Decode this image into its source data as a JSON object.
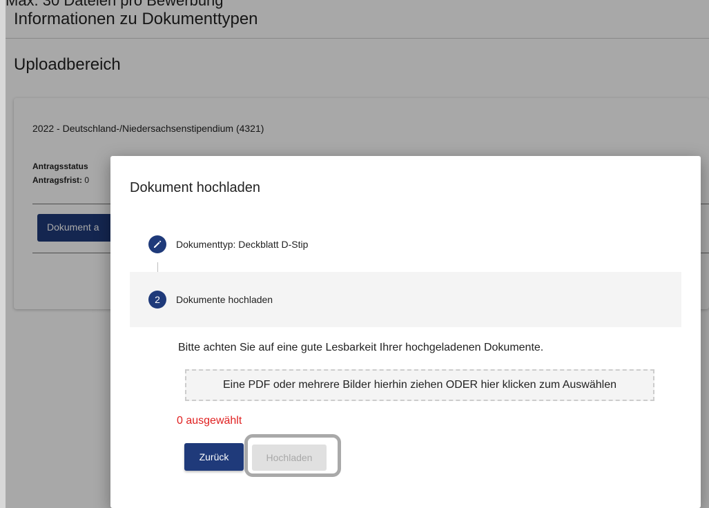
{
  "background": {
    "top_clipped_text": "Max. 30 Dateien pro Bewerbung",
    "info_title": "Informationen zu Dokumenttypen",
    "upload_title": "Uploadbereich",
    "card": {
      "program": "2022 - Deutschland-/Niedersachsenstipendium (4321)",
      "status_label": "Antragsstatus",
      "deadline_label": "Antragsfrist:",
      "deadline_value": "0",
      "button_label": "Dokument a"
    }
  },
  "dialog": {
    "title": "Dokument hochladen",
    "step1": {
      "label": "Dokumenttyp: Deckblatt D-Stip",
      "icon": "pencil-icon"
    },
    "step2": {
      "number": "2",
      "label": "Dokumente hochladen"
    },
    "note": "Bitte achten Sie auf eine gute Lesbarkeit Ihrer hochgeladenen Dokumente.",
    "dropzone_text": "Eine PDF oder mehrere Bilder hierhin ziehen ODER hier klicken zum Auswählen",
    "selected_count": "0 ausgewählt",
    "back_label": "Zurück",
    "upload_label": "Hochladen"
  },
  "colors": {
    "primary": "#1f3a7a",
    "error": "#e02020",
    "disabled_bg": "#e0e0e0",
    "disabled_text": "#a8a8a8",
    "highlight": "#a9a9a9"
  }
}
